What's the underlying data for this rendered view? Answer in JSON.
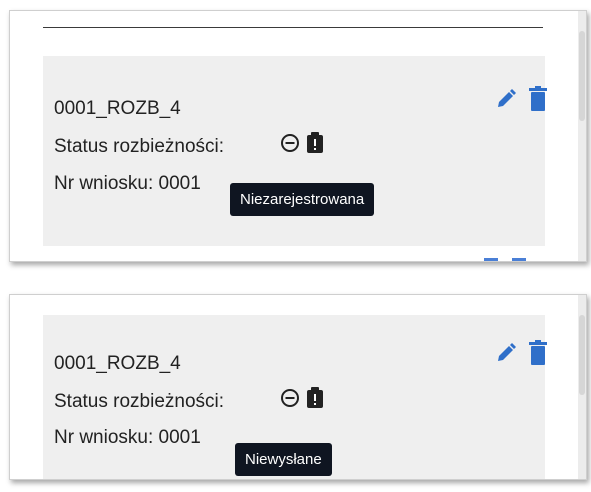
{
  "panels": [
    {
      "record_id": "0001_ROZB_4",
      "status_label": "Status rozbieżności:",
      "request_label": "Nr wniosku: 0001",
      "tooltip": "Niezarejestrowana"
    },
    {
      "record_id": "0001_ROZB_4",
      "status_label": "Status rozbieżności:",
      "request_label": "Nr wniosku: 0001",
      "tooltip": "Niewysłane"
    }
  ],
  "icons": {
    "status_minus": "circle-minus-icon",
    "status_warning": "clipboard-alert-icon",
    "edit": "pencil-icon",
    "delete": "trash-icon"
  },
  "colors": {
    "accent": "#2f6fc9",
    "tooltip_bg": "#0f1521",
    "card_bg": "#efefef"
  }
}
